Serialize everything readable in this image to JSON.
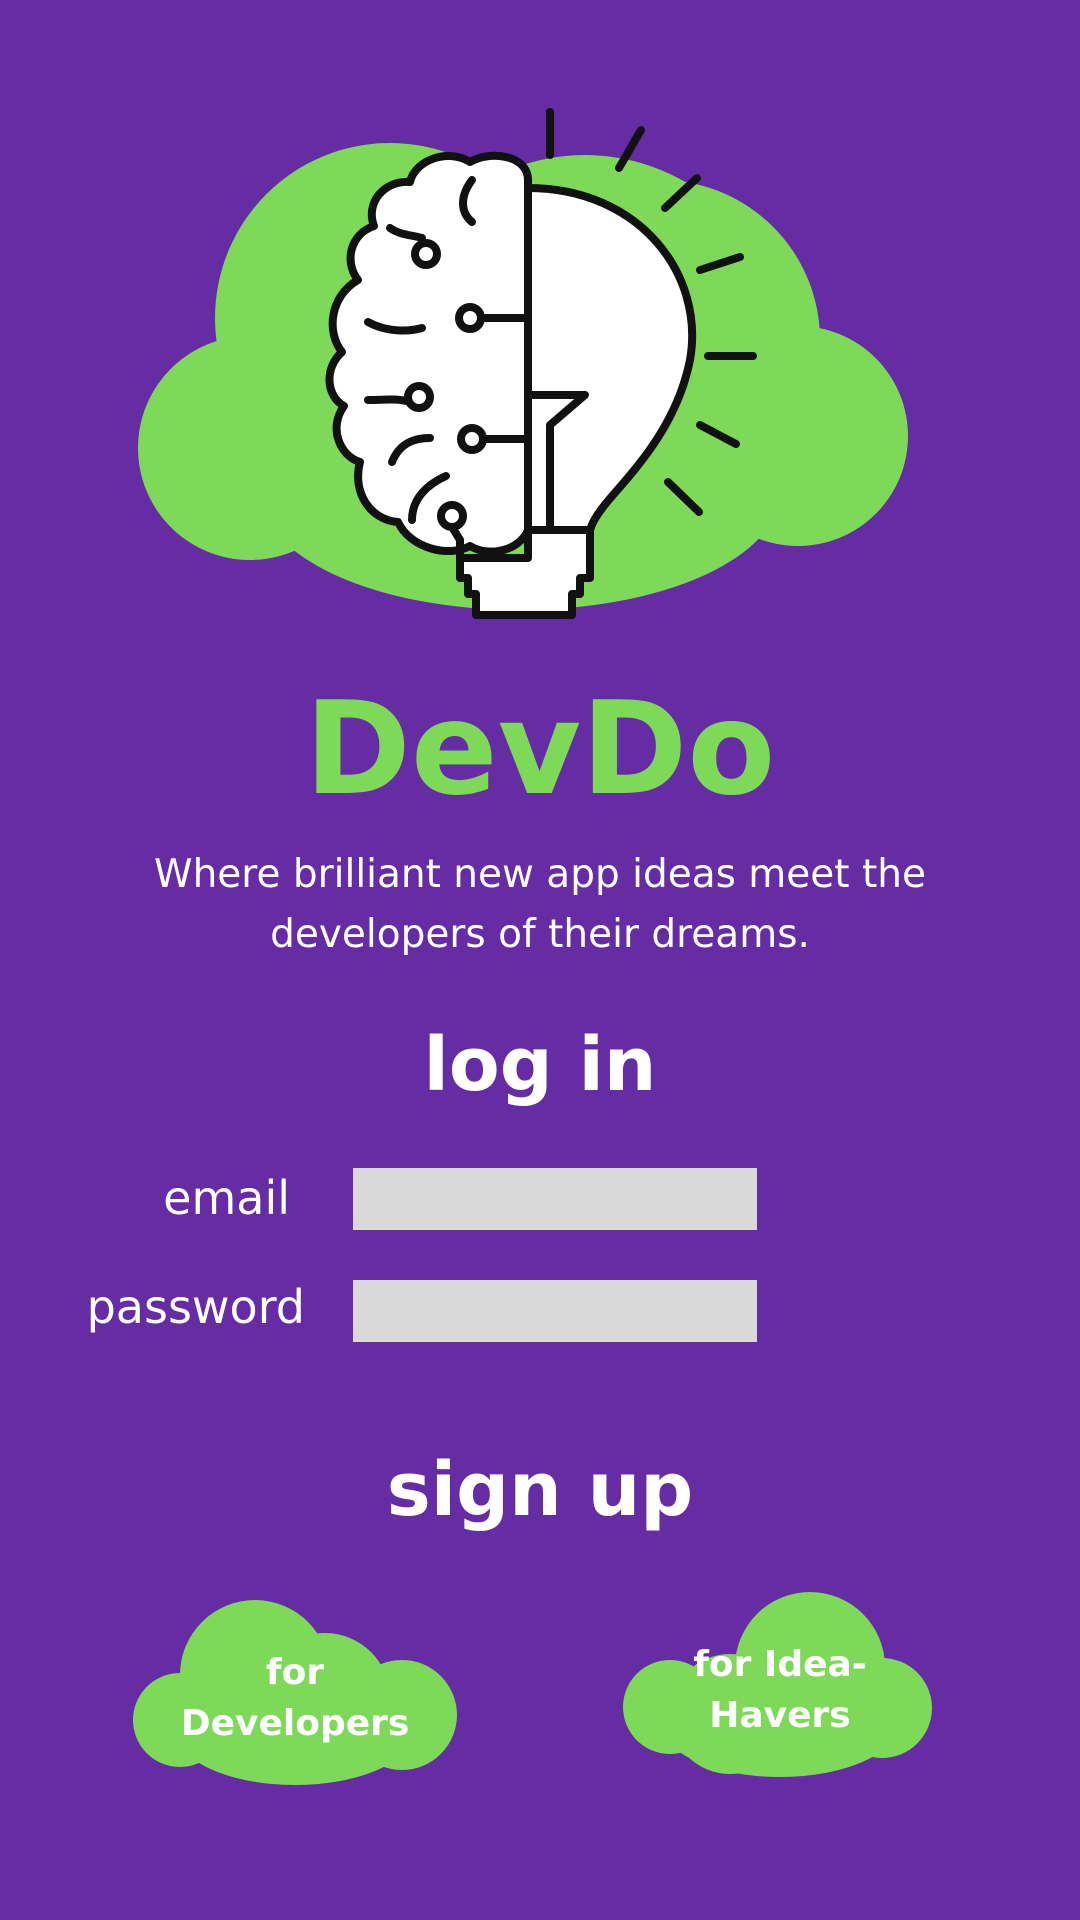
{
  "branding": {
    "app_name": "DevDo",
    "tagline_line1": "Where brilliant new app ideas meet the",
    "tagline_line2": "developers of their dreams.",
    "hero_icon": "brain-lightbulb-icon",
    "accent_color": "#7dd957",
    "background_color": "#652ca3"
  },
  "login": {
    "heading": "log in",
    "email_label": "email",
    "email_value": "",
    "password_label": "password",
    "password_value": "",
    "input_color": "#d9d9d9"
  },
  "signup": {
    "heading": "sign up",
    "developers_line1": "for",
    "developers_line2": "Developers",
    "idea_havers_line1": "for Idea-",
    "idea_havers_line2": "Havers"
  }
}
